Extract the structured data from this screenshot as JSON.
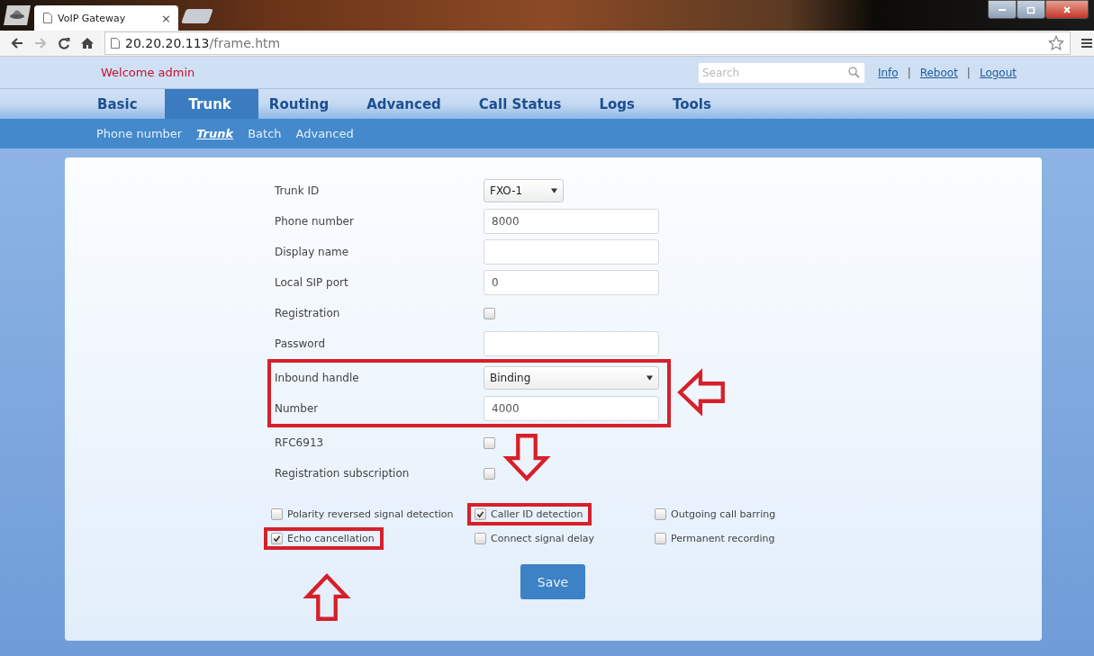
{
  "browser": {
    "tab_title": "VoIP Gateway",
    "tab_close": "×",
    "url_host": "20.20.20.113",
    "url_path": "/frame.htm"
  },
  "header": {
    "welcome": "Welcome admin",
    "search": {
      "placeholder": "Search"
    },
    "links": [
      {
        "kind": "link",
        "label": "Info"
      },
      {
        "kind": "separator",
        "label": "|"
      },
      {
        "kind": "link",
        "label": "Reboot"
      },
      {
        "kind": "separator",
        "label": "|"
      },
      {
        "kind": "link",
        "label": "Logout"
      }
    ]
  },
  "nav": [
    {
      "label": "Basic",
      "selected": false
    },
    {
      "label": "Trunk",
      "selected": true
    },
    {
      "label": "Routing",
      "selected": false
    },
    {
      "label": "Advanced",
      "selected": false
    },
    {
      "label": "Call Status",
      "selected": false
    },
    {
      "label": "Logs",
      "selected": false
    },
    {
      "label": "Tools",
      "selected": false
    }
  ],
  "subnav": [
    {
      "label": "Phone number",
      "selected": false
    },
    {
      "label": "Trunk",
      "selected": true
    },
    {
      "label": "Batch",
      "selected": false
    },
    {
      "label": "Advanced",
      "selected": false
    }
  ],
  "form": {
    "fields": [
      {
        "label": "Trunk ID",
        "kind": "short-select",
        "value": "FXO-1",
        "highlighted": false
      },
      {
        "label": "Phone number",
        "kind": "text",
        "value": "8000",
        "highlighted": false
      },
      {
        "label": "Display name",
        "kind": "text",
        "highlighted": false
      },
      {
        "label": "Local SIP port",
        "kind": "text",
        "value": "0",
        "highlighted": false
      },
      {
        "label": "Registration",
        "kind": "checkbox",
        "checked": false,
        "highlighted": false
      },
      {
        "label": "Password",
        "kind": "text",
        "highlighted": false
      },
      {
        "label": "Inbound handle",
        "kind": "select",
        "value": "Binding",
        "highlighted": true
      },
      {
        "label": "Number",
        "kind": "text",
        "value": "4000",
        "highlighted": true
      },
      {
        "label": "RFC6913",
        "kind": "checkbox",
        "checked": false,
        "highlighted": false
      },
      {
        "label": "Registration subscription",
        "kind": "checkbox",
        "checked": false,
        "highlighted": false
      }
    ],
    "options": [
      {
        "label": "Polarity reversed signal detection",
        "checked": false,
        "highlighted": false
      },
      {
        "label": "Caller ID detection",
        "checked": true,
        "highlighted": true
      },
      {
        "label": "Outgoing call barring",
        "checked": false,
        "highlighted": false
      },
      {
        "label": "Echo cancellation",
        "checked": true,
        "highlighted": true
      },
      {
        "label": "Connect signal delay",
        "checked": false,
        "highlighted": false
      },
      {
        "label": "Permanent recording",
        "checked": false,
        "highlighted": false
      }
    ],
    "save": "Save"
  },
  "annotations": [
    {
      "kind": "left-arrow"
    },
    {
      "kind": "down-arrow"
    },
    {
      "kind": "up-arrow"
    }
  ]
}
